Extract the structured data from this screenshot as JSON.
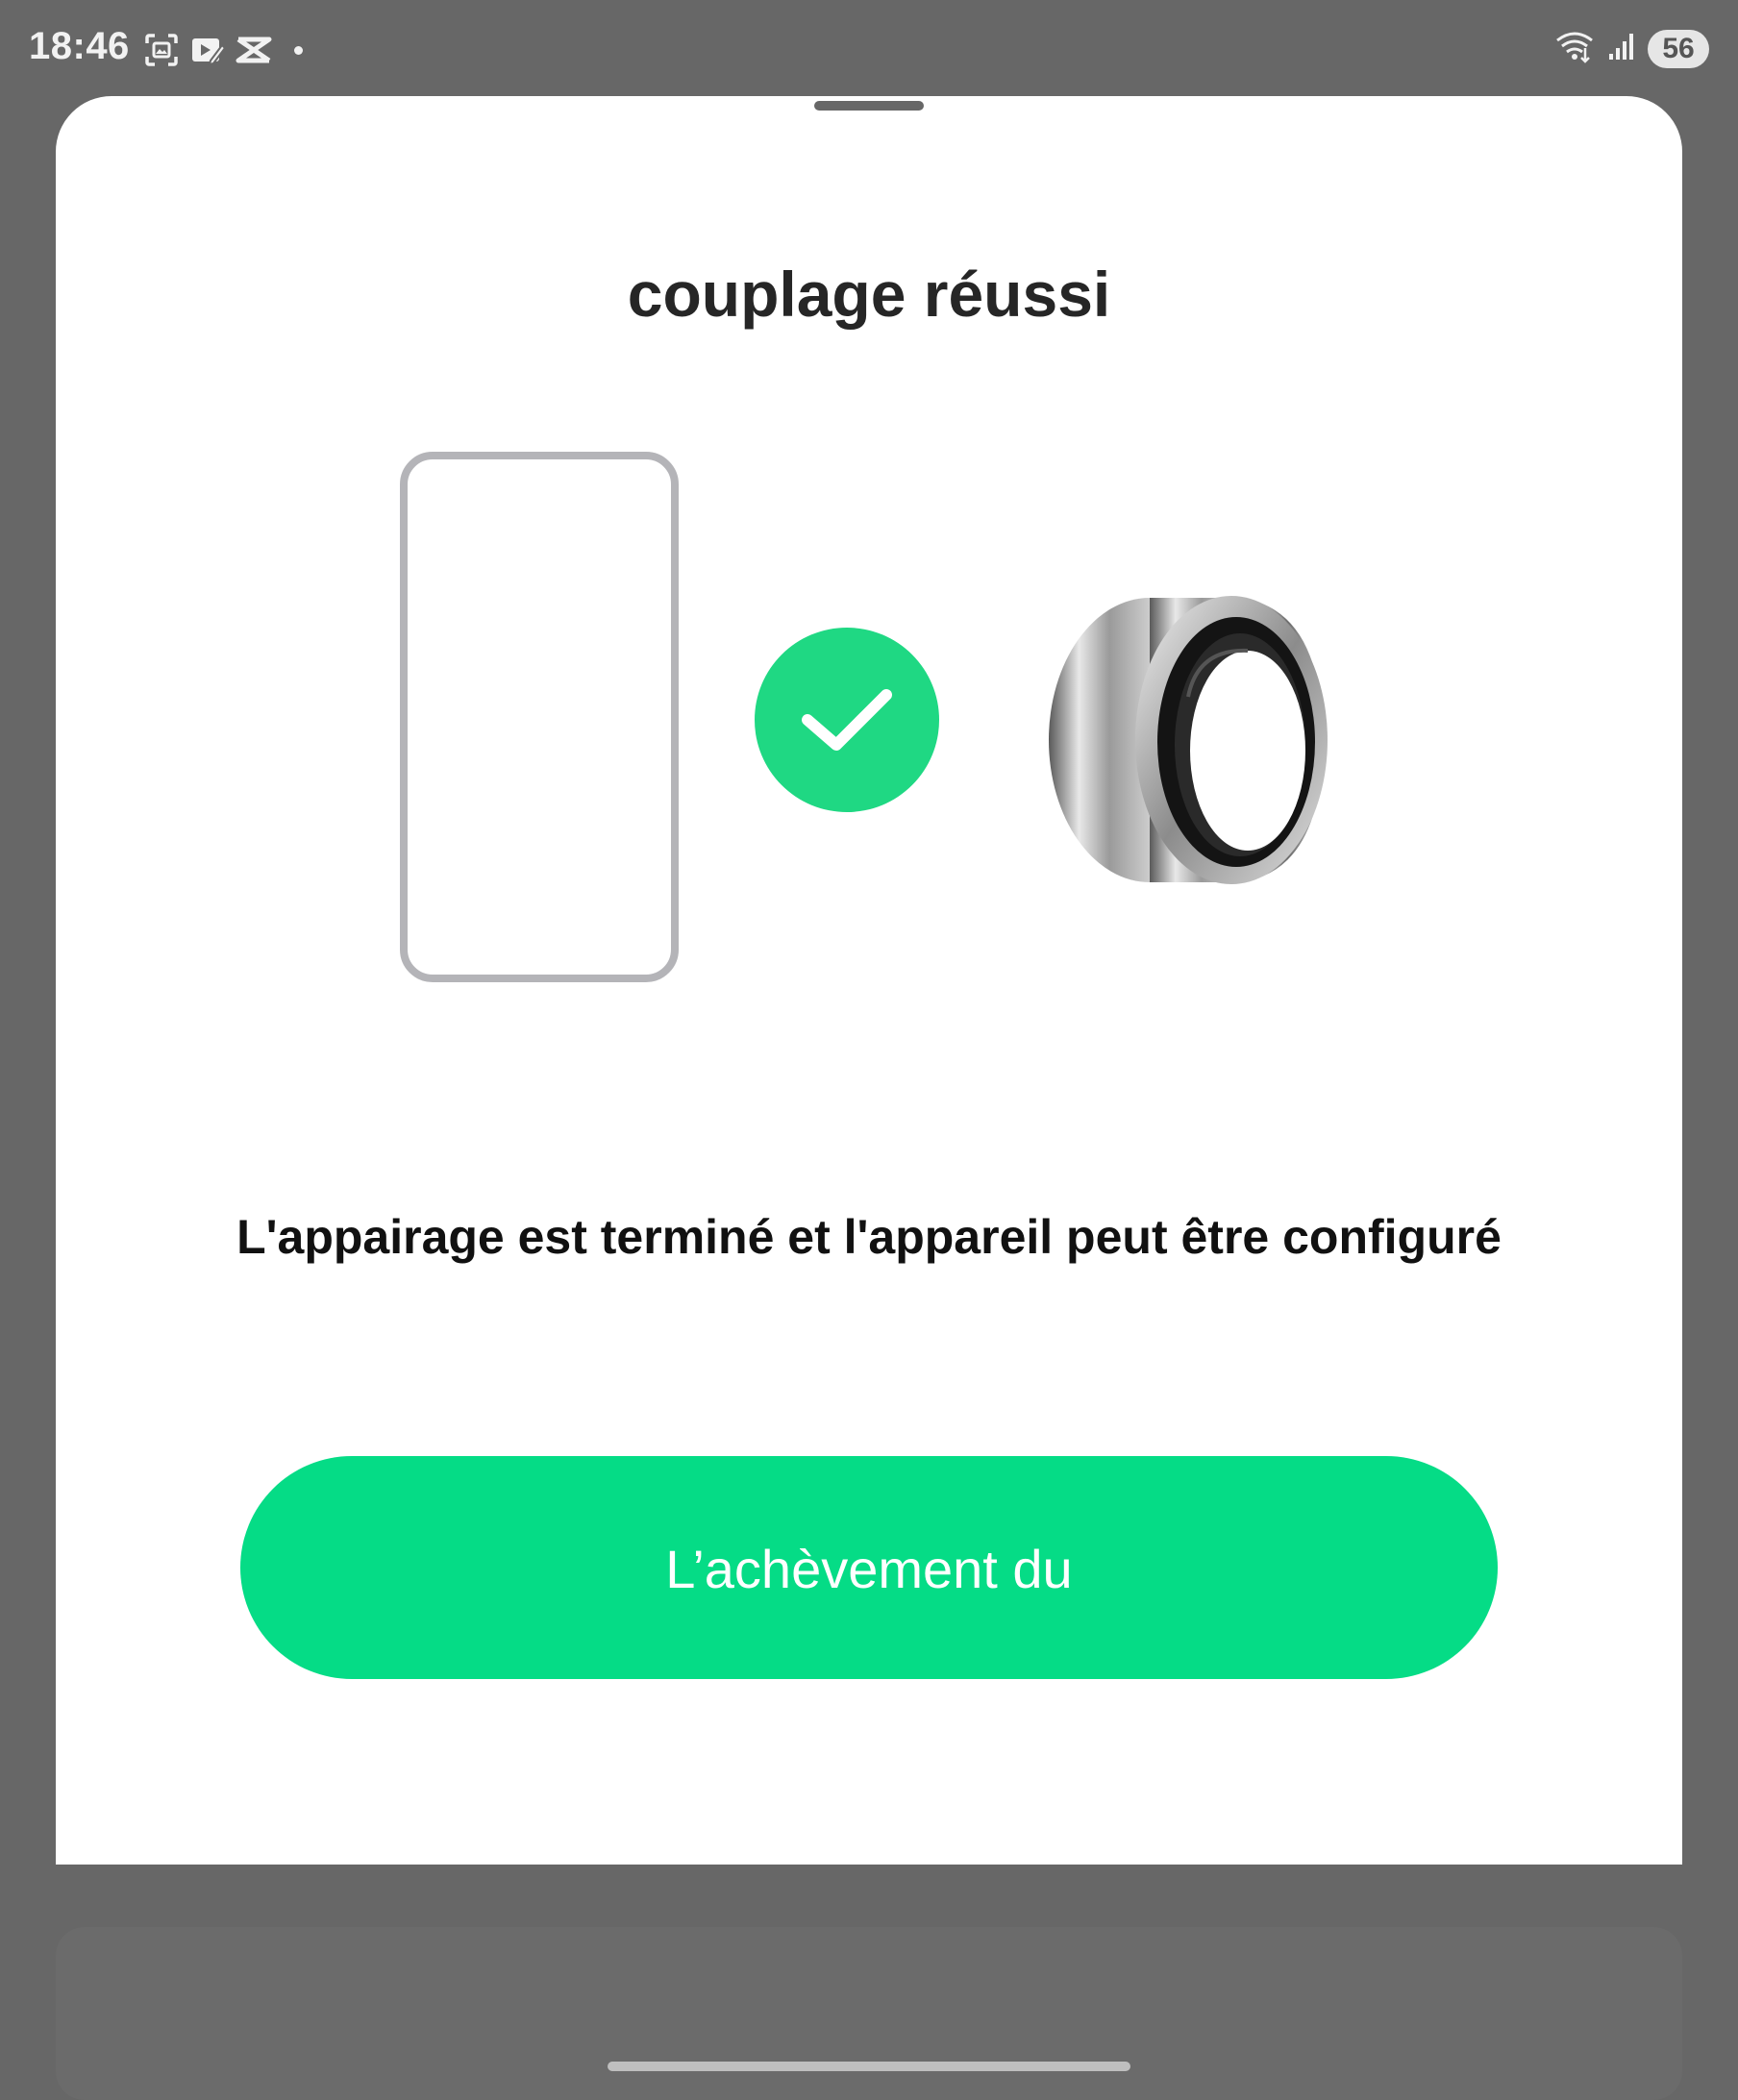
{
  "status_bar": {
    "time": "18:46",
    "left_icons": [
      "screenshot-icon",
      "video-editor-icon",
      "capcut-icon"
    ],
    "battery": "56",
    "right_icons": [
      "wifi-icon",
      "cell-signal-icon"
    ]
  },
  "sheet": {
    "title": "couplage réussi",
    "message": "L'appairage est terminé et l'appareil peut être configuré",
    "button_label": "L’achèvement du"
  },
  "colors": {
    "accent": "#05dc86",
    "check": "#1fd883",
    "phone_outline": "#b4b4b8",
    "backdrop": "#676767"
  }
}
